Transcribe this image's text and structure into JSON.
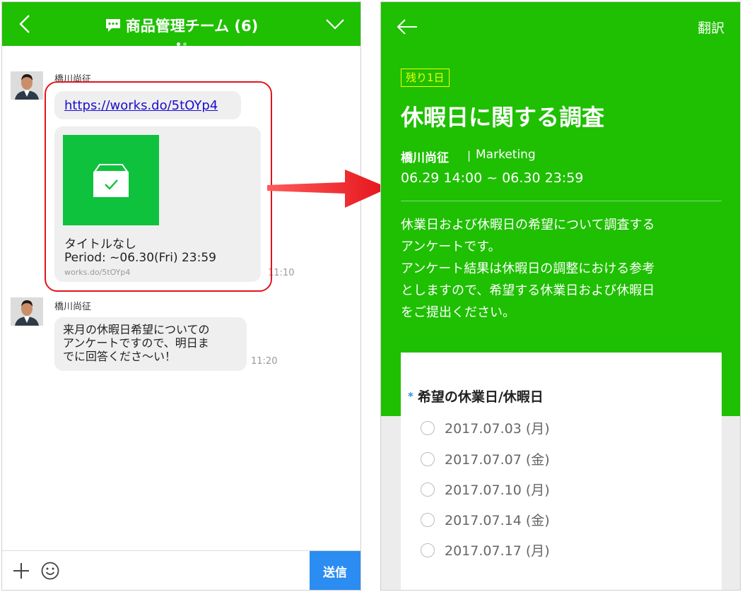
{
  "chat": {
    "room_title": "商品管理チーム (6)",
    "messages": [
      {
        "sender": "橋川尚征",
        "link_text": "https://works.do/5tOYp4",
        "card": {
          "title": "タイトルなし",
          "period": "Period: ~06.30(Fri) 23:59",
          "url": "works.do/5tOYp4"
        },
        "time": "11:10"
      },
      {
        "sender": "橋川尚征",
        "text_lines": [
          "来月の休暇日希望についての",
          "アンケートですので、明日ま",
          "でに回答くださ〜い！"
        ],
        "time": "11:20"
      }
    ],
    "send_label": "送信"
  },
  "survey": {
    "translate_label": "翻訳",
    "badge": "残り1日",
    "title": "休暇日に関する調査",
    "author": "橋川尚征",
    "separator": "|",
    "department": "Marketing",
    "period": "06.29 14:00 ~ 06.30 23:59",
    "description_lines": [
      "休業日および休暇日の希望について調査する",
      "アンケートです。",
      "アンケート結果は休暇日の調整における参考",
      "としますので、希望する休業日および休暇日",
      "をご提出ください。"
    ],
    "question": {
      "required_mark": "*",
      "label": "希望の休業日/休暇日",
      "options": [
        "2017.07.03 (月)",
        "2017.07.07 (金)",
        "2017.07.10 (月)",
        "2017.07.14 (金)",
        "2017.07.17 (月)"
      ]
    }
  },
  "colors": {
    "header_green": "#1fbf02",
    "send_blue": "#2b8cf1",
    "highlight_red": "#e4141b",
    "badge_yellow": "#f0ff00",
    "card_green": "#0ec23d"
  },
  "icons": [
    "back-chevron-icon",
    "chat-bubble-icon",
    "chevron-down-icon",
    "envelope-check-icon",
    "plus-icon",
    "smile-icon",
    "back-arrow-icon"
  ]
}
